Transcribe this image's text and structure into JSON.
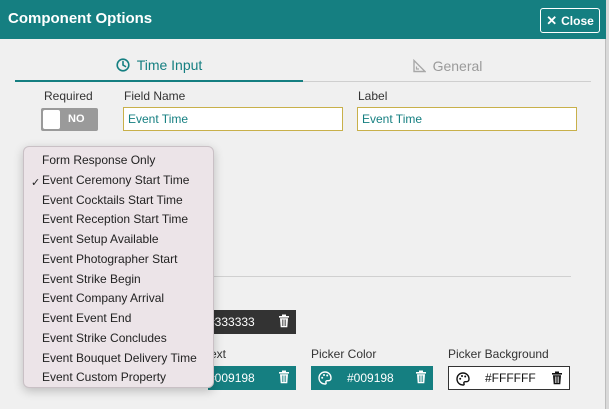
{
  "dialog": {
    "title": "Component Options",
    "close_label": "Close"
  },
  "tabs": [
    {
      "label": "Time Input",
      "active": true
    },
    {
      "label": "General",
      "active": false
    }
  ],
  "form": {
    "required_label": "Required",
    "required_toggle": "NO",
    "field_name_label": "Field Name",
    "field_name_value": "Event Time",
    "label_label": "Label",
    "label_value": "Event Time"
  },
  "colors": {
    "text_color_label_partial": "ext",
    "swatch1_value": "#333333",
    "swatch2_value": "#009198",
    "picker_color_label": "Picker Color",
    "picker_color_value": "#009198",
    "picker_background_label": "Picker Background",
    "picker_background_value": "#FFFFFF",
    "accent": "#157f81"
  },
  "dropdown": {
    "selected_index": 1,
    "items": [
      "Form Response Only",
      "Event Ceremony Start Time",
      "Event Cocktails Start Time",
      "Event Reception Start Time",
      "Event Setup Available",
      "Event Photographer Start",
      "Event Strike Begin",
      "Event Company Arrival",
      "Event Event End",
      "Event Strike Concludes",
      "Event Bouquet Delivery Time",
      "Event Custom Property"
    ]
  }
}
